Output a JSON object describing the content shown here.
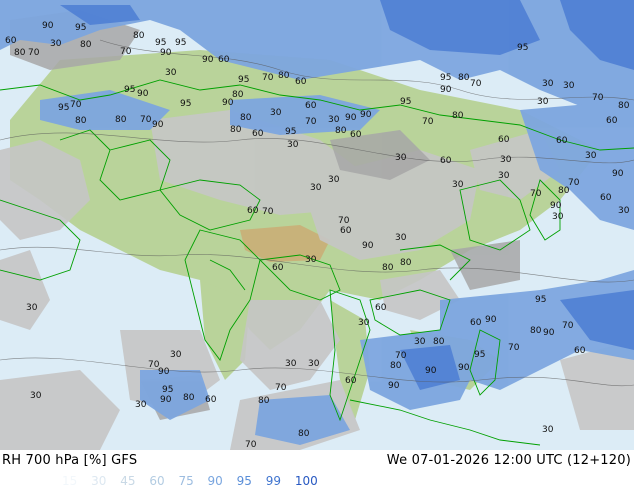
{
  "header": {
    "title": "RH 700 hPa [%] GFS",
    "valid": "We 07-01-2026 12:00 UTC (12+120)"
  },
  "legend": {
    "values": [
      "15",
      "30",
      "45",
      "60",
      "75",
      "90",
      "95",
      "99",
      "100"
    ],
    "colors": [
      "#f2f7fb",
      "#dde8f1",
      "#c9d9e6",
      "#b3cce2",
      "#9dbde0",
      "#7aa6df",
      "#5a8ed8",
      "#3f74cf",
      "#2859c2"
    ]
  },
  "map": {
    "colors": {
      "land": "#b9d39a",
      "land_high": "#c8b27a",
      "rh_low": "#dcecf6",
      "rh_mid_gray": "#c6c6c6",
      "rh_dark_gray": "#a7a7a7",
      "rh_blue": "#7da6df",
      "rh_blue_deep": "#4f7fd4",
      "borders": "#00a000",
      "contour": "#555555"
    },
    "contour_labels": [
      "90",
      "95",
      "80",
      "95",
      "95",
      "60",
      "80",
      "70",
      "30",
      "80",
      "70",
      "90",
      "90",
      "60",
      "95",
      "70",
      "80",
      "60",
      "30",
      "95",
      "90",
      "80",
      "95",
      "70",
      "80",
      "90",
      "95",
      "80",
      "70",
      "80",
      "90",
      "30",
      "80",
      "60",
      "95",
      "30",
      "70",
      "60",
      "30",
      "90",
      "80",
      "60",
      "30",
      "30",
      "30",
      "60",
      "80",
      "70",
      "30",
      "60",
      "30",
      "70",
      "30",
      "60",
      "80",
      "90",
      "30",
      "70",
      "30",
      "60",
      "90",
      "80",
      "30",
      "30",
      "30",
      "60",
      "70",
      "30",
      "30",
      "80",
      "70",
      "60",
      "90",
      "80",
      "95",
      "70",
      "90",
      "60",
      "95",
      "95",
      "70",
      "60",
      "80",
      "90",
      "30",
      "60",
      "95",
      "90",
      "80",
      "70",
      "80",
      "30",
      "60",
      "90",
      "30",
      "70",
      "90",
      "60",
      "30",
      "80",
      "70",
      "95",
      "95",
      "90",
      "80",
      "70",
      "30",
      "80",
      "60",
      "30",
      "70",
      "30",
      "90",
      "30",
      "30",
      "90",
      "80",
      "30",
      "70",
      "90",
      "60"
    ]
  }
}
